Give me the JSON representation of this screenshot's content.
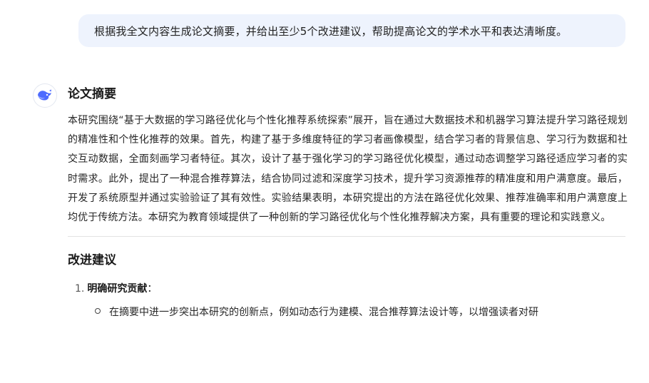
{
  "user_message": "根据我全文内容生成论文摘要，并给出至少5个改进建议，帮助提高论文的学术水平和表达清晰度。",
  "assistant": {
    "avatar_icon": "whale-logo-icon",
    "brand_color": "#4d6bfe",
    "abstract_heading": "论文摘要",
    "abstract_text": "本研究围绕“基于大数据的学习路径优化与个性化推荐系统探索”展开，旨在通过大数据技术和机器学习算法提升学习路径规划的精准性和个性化推荐的效果。首先，构建了基于多维度特征的学习者画像模型，结合学习者的背景信息、学习行为数据和社交互动数据，全面刻画学习者特征。其次，设计了基于强化学习的学习路径优化模型，通过动态调整学习路径适应学习者的实时需求。此外，提出了一种混合推荐算法，结合协同过滤和深度学习技术，提升学习资源推荐的精准度和用户满意度。最后，开发了系统原型并通过实验验证了其有效性。实验结果表明，本研究提出的方法在路径优化效果、推荐准确率和用户满意度上均优于传统方法。本研究为教育领域提供了一种创新的学习路径优化与个性化推荐解决方案，具有重要的理论和实践意义。",
    "suggestions_heading": "改进建议",
    "suggestions": [
      {
        "number": "1.",
        "title": "明确研究贡献",
        "colon": "：",
        "points": [
          "在摘要中进一步突出本研究的创新点，例如动态行为建模、混合推荐算法设计等，以增强读者对研"
        ]
      }
    ]
  }
}
